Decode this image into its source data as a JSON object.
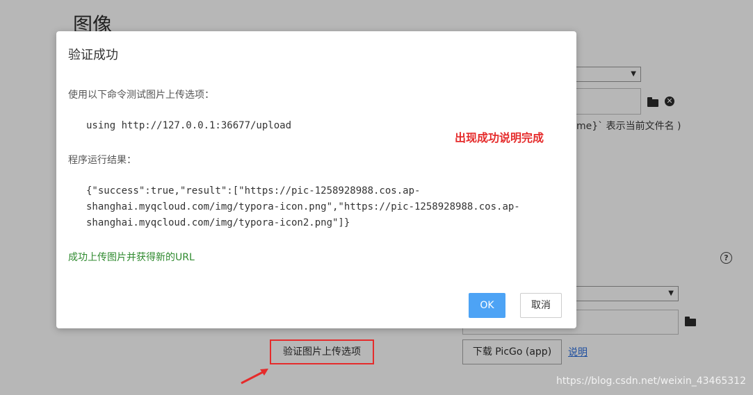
{
  "background": {
    "section_title": "图像",
    "filename_hint": "me}` 表示当前文件名 )",
    "download_button": "下载 PicGo (app)",
    "explain_link": "说明",
    "verify_button": "验证图片上传选项",
    "watermark": "https://blog.csdn.net/weixin_43465312"
  },
  "dialog": {
    "title": "验证成功",
    "command_label": "使用以下命令测试图片上传选项：",
    "command": "using http://127.0.0.1:36677/upload",
    "result_label": "程序运行结果：",
    "result_lines": [
      "{\"success\":true,\"result\":[\"https://pic-1258928988.cos.ap-",
      "shanghai.myqcloud.com/img/typora-icon.png\",\"https://pic-1258928988.cos.ap-",
      "shanghai.myqcloud.com/img/typora-icon2.png\"]}"
    ],
    "success_message": "成功上传图片并获得新的URL",
    "ok_label": "OK",
    "cancel_label": "取消"
  },
  "annotations": {
    "success_note": "出现成功说明完成"
  },
  "colors": {
    "overlay_bg": "#b7b7b7",
    "ok_button": "#4da3f5",
    "success_text": "#2f8a2f",
    "annotation_red": "#e52b2b"
  }
}
